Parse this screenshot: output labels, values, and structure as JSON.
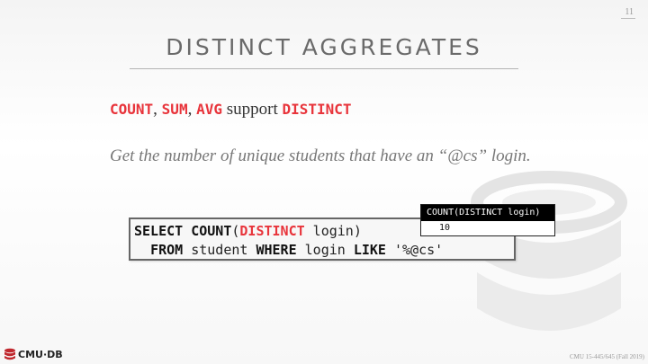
{
  "slide": {
    "page_number": "11",
    "title": "DISTINCT AGGREGATES",
    "bullet": {
      "kw1": "COUNT",
      "sep1": ", ",
      "kw2": "SUM",
      "sep2": ", ",
      "kw3": "AVG",
      "middle": " support ",
      "kw4": "DISTINCT"
    },
    "description": "Get the number of unique students that have an “@cs” login.",
    "sql": {
      "line1": {
        "select": "SELECT",
        "count": " COUNT",
        "open": "(",
        "distinct": "DISTINCT",
        "rest": " login)"
      },
      "line2": {
        "indent": "  ",
        "from": "FROM",
        "table": " student ",
        "where": "WHERE",
        "col": " login ",
        "like": "LIKE",
        "pattern": " '%@cs'"
      }
    },
    "result": {
      "header": "COUNT(DISTINCT login)",
      "value": "10"
    },
    "footer": {
      "logo_text": "CMU·DB",
      "credit": "CMU 15-445/645 (Fall 2019)"
    }
  },
  "colors": {
    "accent_red": "#e8343b",
    "title_gray": "#6a6a6a",
    "watermark": "#e6e6e6"
  },
  "icons": {
    "watermark": "database-cylinder-icon",
    "logo": "database-logo-icon"
  }
}
